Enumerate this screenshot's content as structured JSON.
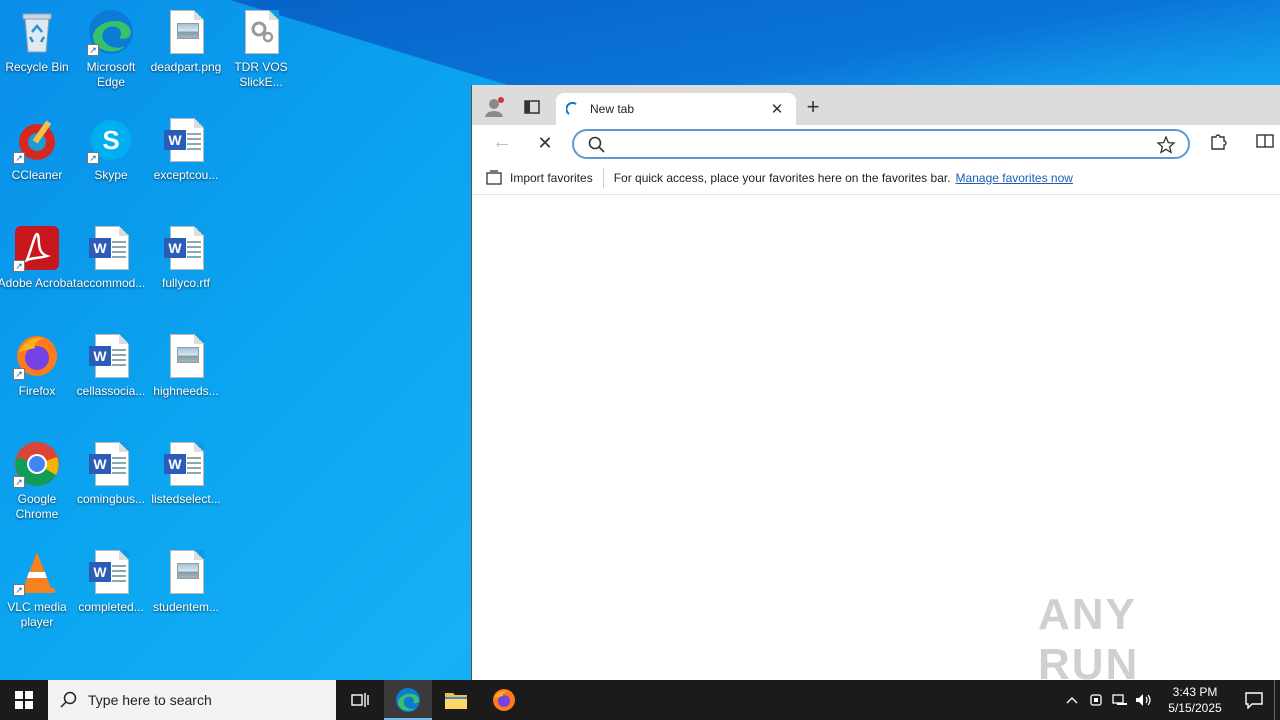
{
  "desktop": {
    "icons": [
      {
        "label": "Recycle Bin",
        "icon": "recycle-bin-icon"
      },
      {
        "label": "Microsoft Edge",
        "icon": "edge-icon"
      },
      {
        "label": "deadpart.png",
        "icon": "image-file-icon"
      },
      {
        "label": "TDR VOS SlickE...",
        "icon": "settings-file-icon"
      },
      {
        "label": "CCleaner",
        "icon": "ccleaner-icon"
      },
      {
        "label": "Skype",
        "icon": "skype-icon"
      },
      {
        "label": "exceptcou...",
        "icon": "word-doc-icon"
      },
      {
        "label": "Adobe Acrobat",
        "icon": "acrobat-icon"
      },
      {
        "label": "accommod...",
        "icon": "word-doc-icon"
      },
      {
        "label": "fullyco.rtf",
        "icon": "word-doc-icon"
      },
      {
        "label": "Firefox",
        "icon": "firefox-icon"
      },
      {
        "label": "cellassocia...",
        "icon": "word-doc-icon"
      },
      {
        "label": "highneeds...",
        "icon": "image-file-icon"
      },
      {
        "label": "Google Chrome",
        "icon": "chrome-icon"
      },
      {
        "label": "comingbus...",
        "icon": "word-doc-icon"
      },
      {
        "label": "listedselect...",
        "icon": "word-doc-icon"
      },
      {
        "label": "VLC media player",
        "icon": "vlc-icon"
      },
      {
        "label": "completed...",
        "icon": "word-doc-icon"
      },
      {
        "label": "studentem...",
        "icon": "image-file-icon"
      }
    ]
  },
  "browser": {
    "tab_title": "New tab",
    "address_value": "",
    "favorites_bar": {
      "import_label": "Import favorites",
      "hint": "For quick access, place your favorites here on the favorites bar.",
      "manage_link": "Manage favorites now"
    }
  },
  "watermark": "ANY RUN",
  "taskbar": {
    "search_placeholder": "Type here to search",
    "time": "3:43 PM",
    "date": "5/15/2025"
  }
}
